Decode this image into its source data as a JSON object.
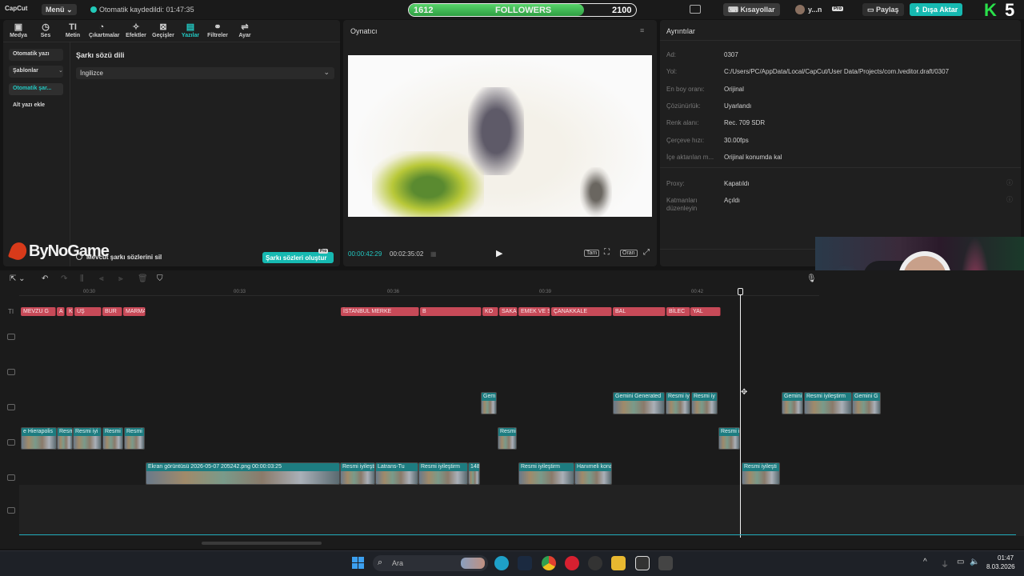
{
  "app": {
    "logo": "CapCut",
    "menu_label": "Menü",
    "autosave_text": "Otomatik kaydedildi: 01:47:35"
  },
  "followers_bar": {
    "current": "1612",
    "label": "FOLLOWERS",
    "goal": "2100",
    "progress": 0.77
  },
  "top_right": {
    "shortcuts": "Kısayollar",
    "user": "y...n",
    "pro_badge": "Pro",
    "share": "Paylaş",
    "export": "Dışa Aktar",
    "corner_k": "K",
    "corner_5": "5"
  },
  "toolbar": {
    "items": [
      {
        "label": "Medya",
        "icon": "media-icon"
      },
      {
        "label": "Ses",
        "icon": "audio-icon"
      },
      {
        "label": "Metin",
        "icon": "text-icon"
      },
      {
        "label": "Çıkartmalar",
        "icon": "sticker-icon"
      },
      {
        "label": "Efektler",
        "icon": "effects-icon"
      },
      {
        "label": "Geçişler",
        "icon": "transitions-icon"
      },
      {
        "label": "Yazılar",
        "icon": "captions-icon"
      },
      {
        "label": "Filtreler",
        "icon": "filters-icon"
      },
      {
        "label": "Ayar",
        "icon": "adjust-icon"
      }
    ]
  },
  "left_sidebar": {
    "items": [
      {
        "label": "Otomatik yazı"
      },
      {
        "label": "Şablonlar"
      },
      {
        "label": "Otomatik şar..."
      },
      {
        "label": "Alt yazı ekle"
      }
    ]
  },
  "lyrics_panel": {
    "title": "Şarkı sözü dili",
    "language": "İngilizce",
    "delete_text": "Mevcut şarkı sözlerini sil",
    "create_button": "Şarkı sözleri oluştur",
    "pro_badge": "Pro",
    "watermark": "ByNoGame"
  },
  "player": {
    "title": "Oynatıcı",
    "current_time": "00:00:42:29",
    "total_time": "00:02:35:02",
    "full_label": "Tam",
    "ratio_label": "Oran"
  },
  "details": {
    "title": "Ayrıntılar",
    "rows": [
      {
        "label": "Ad:",
        "value": "0307"
      },
      {
        "label": "Yol:",
        "value": "C:/Users/PC/AppData/Local/CapCut/User Data/Projects/com.lveditor.draft/0307"
      },
      {
        "label": "En boy oranı:",
        "value": "Orijinal"
      },
      {
        "label": "Çözünürlük:",
        "value": "Uyarlandı"
      },
      {
        "label": "Renk alanı:",
        "value": "Rec. 709 SDR"
      },
      {
        "label": "Çerçeve hızı:",
        "value": "30.00fps"
      },
      {
        "label": "İçe aktarılan m...",
        "value": "Orijinal konumda kal"
      }
    ],
    "proxy_label": "Proxy:",
    "proxy_value": "Kapatıldı",
    "layers_label": "Katmanları düzenleyin",
    "layers_value": "Açıldı"
  },
  "timeline": {
    "ruler": [
      "00:30",
      "00:33",
      "00:36",
      "00:39",
      "00:42"
    ],
    "text_clips": [
      "MEVZU G",
      "A",
      "KÜTA",
      "UŞ",
      "BUR",
      "MARMARANIN NABZI",
      "İSTANBUL MERKE",
      "B",
      "KO",
      "SAKAR",
      "EMEK VE SENTEZ",
      "ÇANAKKALE",
      "BAL",
      "BİLEC",
      "YAL"
    ],
    "overlay_clips": [
      "Gem",
      "Gemini Generated",
      "Resmi iy",
      "Resmi iy",
      "Gemini",
      "Resmi iyileştirm",
      "Gemini G"
    ],
    "track2_clips": [
      "e Hierapolis",
      "Resm",
      "Resmi iyi",
      "Resmi",
      "Resmi",
      "Resmi",
      "Resmi i"
    ],
    "main_clips": [
      "Ekran görüntüsü 2026-05-07 205242.png   00:00:03:25",
      "Resmi iyileştirm",
      "Latrans-Tu",
      "Resmi iyileştirm",
      "148",
      "Resmi iyileştirm",
      "Hanımeli konağı",
      "Resmi iyileşti"
    ]
  },
  "taskbar": {
    "search_placeholder": "Ara",
    "time": "01:47",
    "date": "8.03.2026"
  }
}
